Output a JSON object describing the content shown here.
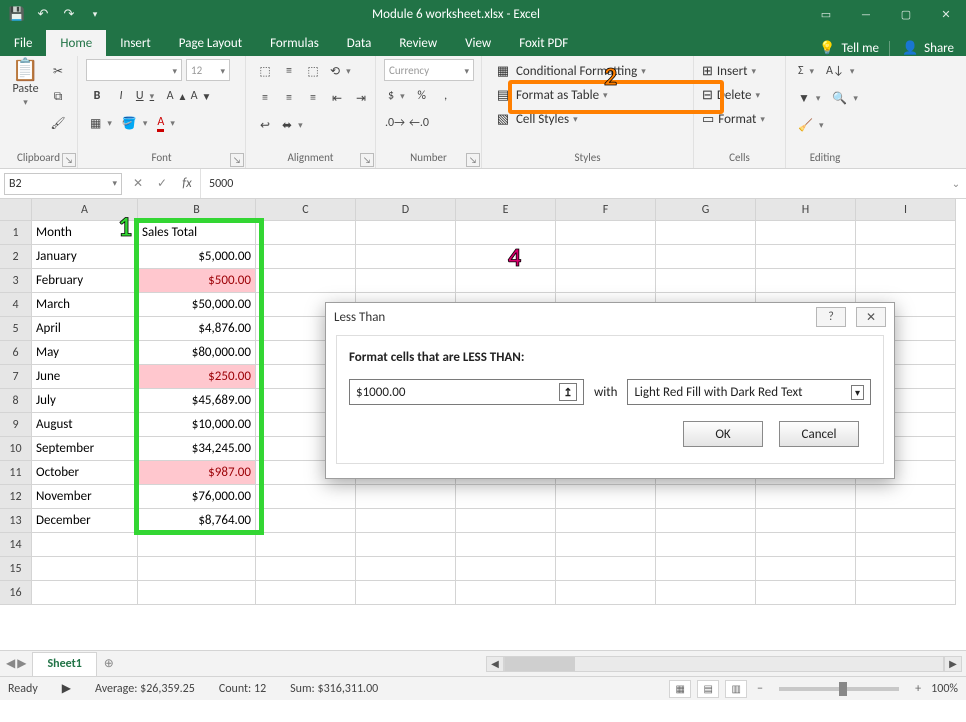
{
  "titlebar": {
    "title": "Module 6 worksheet.xlsx  -  Excel"
  },
  "tabs": {
    "file": "File",
    "home": "Home",
    "insert": "Insert",
    "page_layout": "Page Layout",
    "formulas": "Formulas",
    "data": "Data",
    "review": "Review",
    "view": "View",
    "foxit": "Foxit PDF",
    "tellme": "Tell me",
    "share": "Share"
  },
  "ribbon": {
    "clipboard": {
      "label": "Clipboard",
      "paste": "Paste"
    },
    "font": {
      "label": "Font",
      "size": "12",
      "bold": "B",
      "italic": "I",
      "underline": "U"
    },
    "alignment": {
      "label": "Alignment"
    },
    "number": {
      "label": "Number",
      "format": "Currency",
      "currency": "$",
      "percent": "%"
    },
    "styles": {
      "label": "Styles",
      "conditional": "Conditional Formatting",
      "fat": "Format as Table",
      "cellstyles": "Cell Styles"
    },
    "cells": {
      "label": "Cells",
      "insert": "Insert",
      "delete": "Delete",
      "format": "Format"
    },
    "editing": {
      "label": "Editing"
    }
  },
  "namebox": "B2",
  "formula_value": "5000",
  "columns": [
    "A",
    "B",
    "C",
    "D",
    "E",
    "F",
    "G",
    "H",
    "I"
  ],
  "rows": [
    {
      "n": "1",
      "a": "Month",
      "b": "Sales Total",
      "b_align": "left"
    },
    {
      "n": "2",
      "a": "January",
      "b": "$5,000.00"
    },
    {
      "n": "3",
      "a": "February",
      "b": "$500.00",
      "red": true
    },
    {
      "n": "4",
      "a": "March",
      "b": "$50,000.00"
    },
    {
      "n": "5",
      "a": "April",
      "b": "$4,876.00"
    },
    {
      "n": "6",
      "a": "May",
      "b": "$80,000.00"
    },
    {
      "n": "7",
      "a": "June",
      "b": "$250.00",
      "red": true
    },
    {
      "n": "8",
      "a": "July",
      "b": "$45,689.00"
    },
    {
      "n": "9",
      "a": "August",
      "b": "$10,000.00"
    },
    {
      "n": "10",
      "a": "September",
      "b": "$34,245.00"
    },
    {
      "n": "11",
      "a": "October",
      "b": "$987.00",
      "red": true
    },
    {
      "n": "12",
      "a": "November",
      "b": "$76,000.00"
    },
    {
      "n": "13",
      "a": "December",
      "b": "$8,764.00"
    },
    {
      "n": "14",
      "a": "",
      "b": ""
    },
    {
      "n": "15",
      "a": "",
      "b": ""
    },
    {
      "n": "16",
      "a": "",
      "b": ""
    }
  ],
  "sheet_tab": "Sheet1",
  "status": {
    "ready": "Ready",
    "average": "Average: $26,359.25",
    "count": "Count: 12",
    "sum": "Sum: $316,311.00",
    "zoom": "100%"
  },
  "dialog": {
    "title": "Less Than",
    "prompt": "Format cells that are LESS THAN:",
    "value": "$1000.00",
    "with": "with",
    "format": "Light Red Fill with Dark Red Text",
    "ok": "OK",
    "cancel": "Cancel",
    "help": "?",
    "close": "✕"
  },
  "callouts": {
    "one": "1",
    "two": "2",
    "four": "4"
  }
}
